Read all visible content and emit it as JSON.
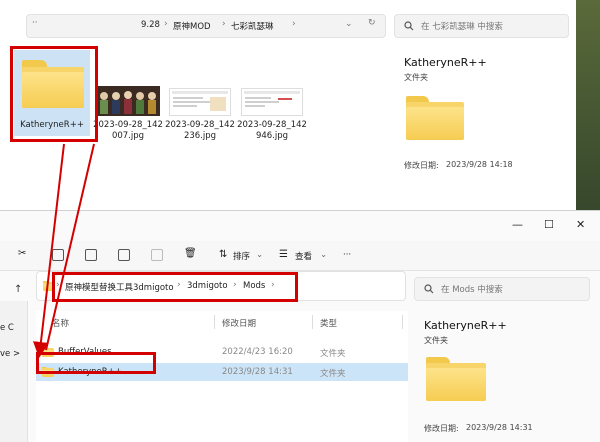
{
  "top_window": {
    "breadcrumb": [
      "9.28",
      "原神MOD",
      "七彩凯瑟琳"
    ],
    "search_placeholder": "在 七彩凯瑟琳 中搜索",
    "items": [
      {
        "name": "KatheryneR++",
        "kind": "folder"
      },
      {
        "name": "2023-09-28_142007.jpg",
        "kind": "image"
      },
      {
        "name": "2023-09-28_142236.jpg",
        "kind": "image"
      },
      {
        "name": "2023-09-28_142946.jpg",
        "kind": "image"
      }
    ],
    "item_labels": {
      "folder": "KatheryneR++",
      "img1_l1": "2023-09-28_142",
      "img1_l2": "007.jpg",
      "img2_l1": "2023-09-28_142",
      "img2_l2": "236.jpg",
      "img3_l1": "2023-09-28_142",
      "img3_l2": "946.jpg"
    },
    "details": {
      "name": "KatheryneR++",
      "type": "文件夹",
      "modified_label": "修改日期:",
      "modified_value": "2023/9/28 14:18"
    }
  },
  "bottom_window": {
    "controls": {
      "minimize": "—",
      "maximize": "☐",
      "close": "✕"
    },
    "toolbar": {
      "sort": "排序",
      "view": "查看",
      "more": "···"
    },
    "breadcrumb": [
      "原神模型替换工具3dmigoto",
      "3dmigoto",
      "Mods"
    ],
    "search_placeholder": "在 Mods 中搜索",
    "nav_fragments": [
      "e C",
      "ve >"
    ],
    "columns": {
      "name": "名称",
      "modified": "修改日期",
      "type": "类型"
    },
    "rows": [
      {
        "name": "BufferValues",
        "modified": "2022/4/23 16:20",
        "type": "文件夹",
        "selected": false
      },
      {
        "name": "KatheryneR++",
        "modified": "2023/9/28 14:31",
        "type": "文件夹",
        "selected": true
      }
    ],
    "details": {
      "name": "KatheryneR++",
      "type": "文件夹",
      "modified_label": "修改日期:",
      "modified_value": "2023/9/28 14:31"
    }
  },
  "colors": {
    "accent_red": "#d40000",
    "selection": "#cce4f7",
    "folder": "#f7d56a"
  }
}
